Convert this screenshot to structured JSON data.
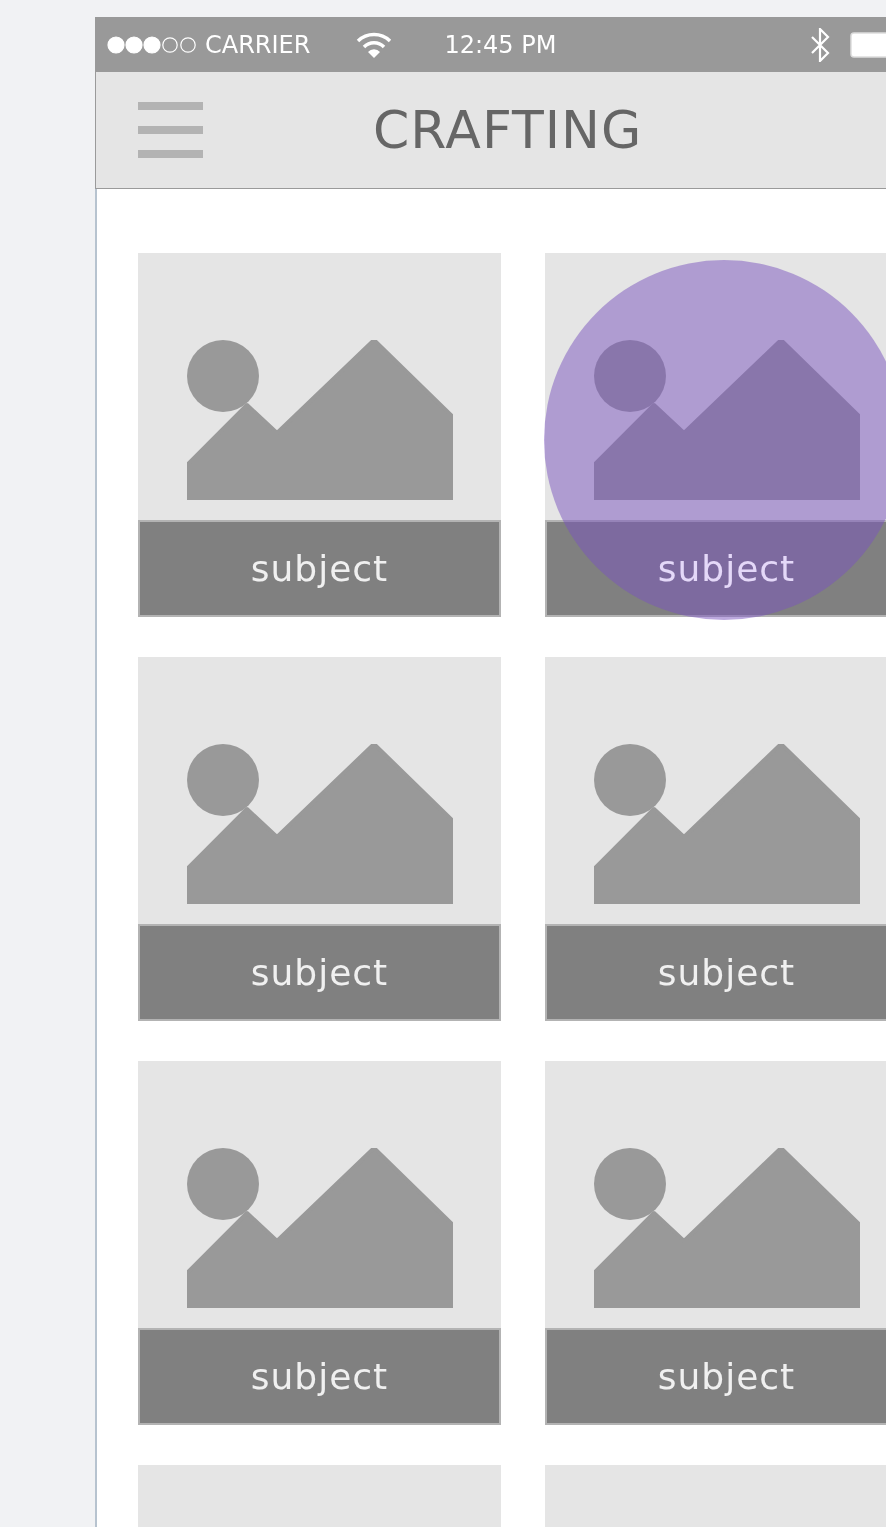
{
  "status_bar": {
    "carrier": "CARRIER",
    "time": "12:45 PM"
  },
  "nav_bar": {
    "title": "CRAFTING"
  },
  "cards": [
    {
      "caption": "subject",
      "pressed": false
    },
    {
      "caption": "subject",
      "pressed": true
    },
    {
      "caption": "subject",
      "pressed": false
    },
    {
      "caption": "subject",
      "pressed": false
    },
    {
      "caption": "subject",
      "pressed": false
    },
    {
      "caption": "subject",
      "pressed": false
    },
    {
      "pressed": false
    },
    {
      "pressed": false
    }
  ]
}
